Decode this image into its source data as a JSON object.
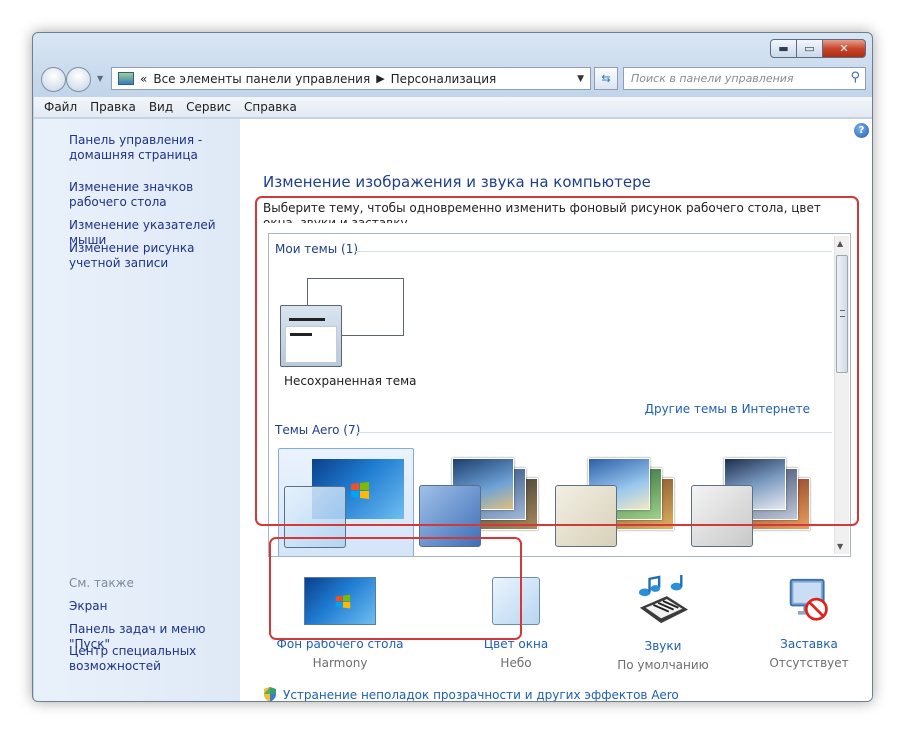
{
  "window": {
    "controls": {
      "minimize": "▬",
      "maximize": "▭",
      "close": "✕"
    }
  },
  "nav": {
    "back_icon": "back-arrow-icon",
    "forward_icon": "forward-arrow-icon",
    "breadcrumb": [
      "Все элементы панели управления",
      "Персонализация"
    ],
    "search_placeholder": "Поиск в панели управления"
  },
  "menu": [
    "Файл",
    "Правка",
    "Вид",
    "Сервис",
    "Справка"
  ],
  "sidebar": {
    "links": [
      "Панель управления - домашняя страница",
      "Изменение значков рабочего стола",
      "Изменение указателей мыши",
      "Изменение рисунка учетной записи"
    ],
    "see_also_title": "См. также",
    "see_also": [
      "Экран",
      "Панель задач и меню \"Пуск\"",
      "Центр специальных возможностей"
    ]
  },
  "main": {
    "title": "Изменение изображения и звука на компьютере",
    "description": "Выберите тему, чтобы одновременно изменить фоновый рисунок рабочего стола, цвет окна, звуки и заставку.",
    "my_themes_title": "Мои темы (1)",
    "unsaved_theme_label": "Несохраненная тема",
    "online_themes_link": "Другие темы в Интернете",
    "aero_themes_title": "Темы Aero (7)"
  },
  "bottom": {
    "desktop_bg": {
      "title": "Фон рабочего стола",
      "value": "Harmony"
    },
    "window_color": {
      "title": "Цвет окна",
      "value": "Небо"
    },
    "sounds": {
      "title": "Звуки",
      "value": "По умолчанию"
    },
    "screensaver": {
      "title": "Заставка",
      "value": "Отсутствует"
    },
    "aero_fix_link": "Устранение неполадок прозрачности и других эффектов Aero"
  },
  "colors": {
    "link": "#1e5fb0",
    "heading": "#1e3f8a",
    "sidebar_link": "#1e3287",
    "highlight_box": "#d23a3a"
  }
}
